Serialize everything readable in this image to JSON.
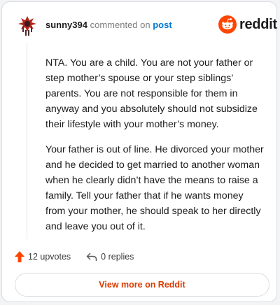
{
  "comment": {
    "username": "sunny394",
    "action_text": "commented on",
    "post_link": "post",
    "paragraphs": [
      "NTA. You are a child. You are not your father or step mother’s spouse or your step siblings’ parents. You are not responsible for them in anyway and you absolutely should not subsidize their lifestyle with your mother’s money.",
      "Your father is out of line. He divorced your mother and he decided to get married to another woman when he clearly didn’t have the means to raise a family. Tell your father that if he wants money from your mother, he should speak to her directly and leave you out of it."
    ]
  },
  "brand": {
    "wordmark": "reddit",
    "accent": "#ff4500"
  },
  "actions": {
    "upvotes": "12 upvotes",
    "replies": "0 replies"
  },
  "view_more": "View more on Reddit",
  "icons": [
    "avatar",
    "reddit-logo-icon",
    "upvote-arrow-icon",
    "reply-arrow-icon"
  ]
}
